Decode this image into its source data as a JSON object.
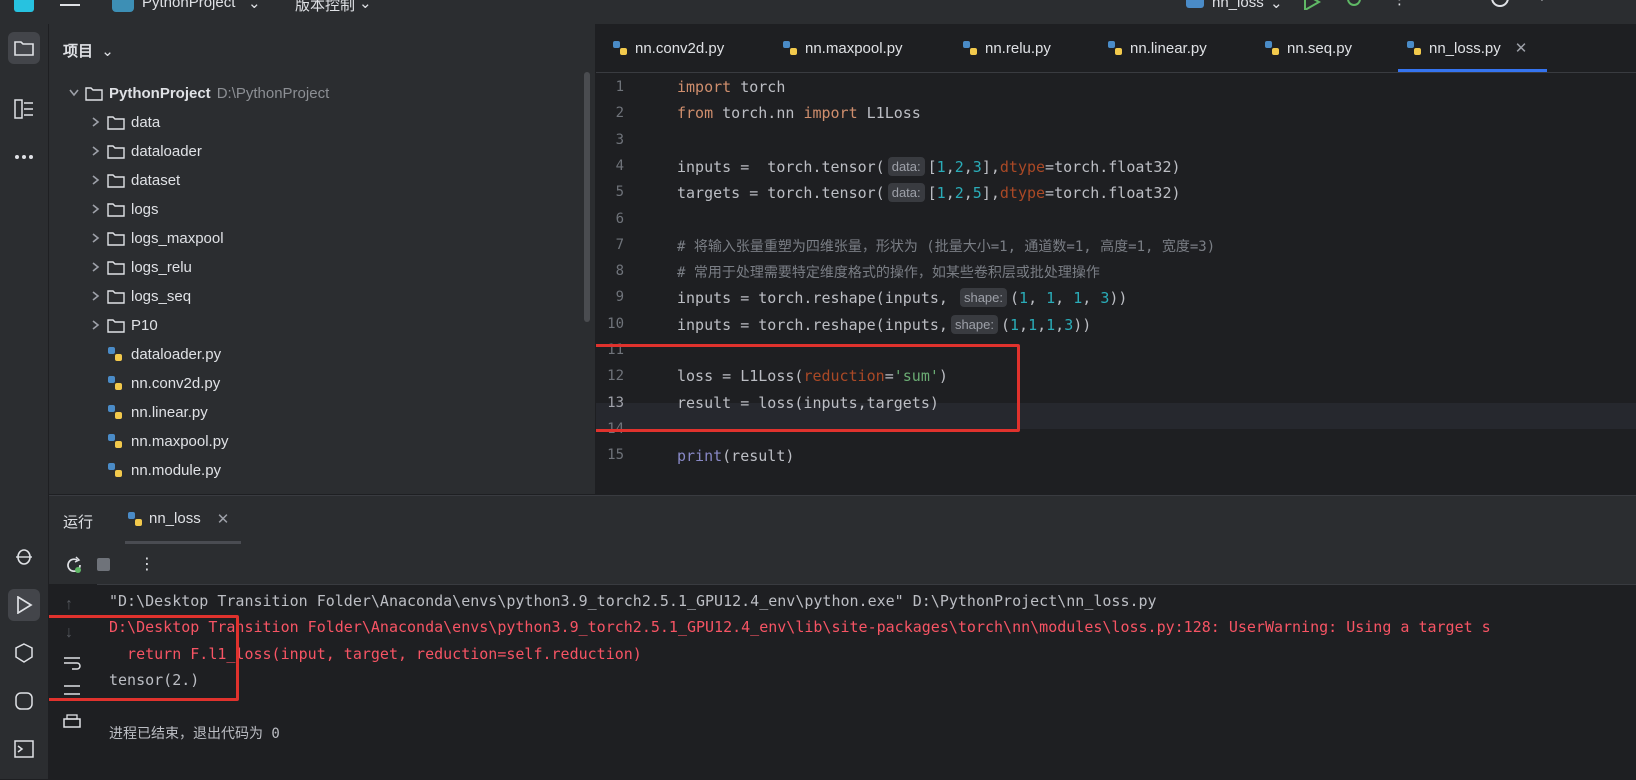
{
  "titlebar": {
    "project_name": "PythonProject",
    "vcs_label": "版本控制",
    "run_config": "nn_loss"
  },
  "project_panel": {
    "title": "项目",
    "root": {
      "name": "PythonProject",
      "path": "D:\\PythonProject"
    },
    "folders": [
      "data",
      "dataloader",
      "dataset",
      "logs",
      "logs_maxpool",
      "logs_relu",
      "logs_seq",
      "P10"
    ],
    "files": [
      "dataloader.py",
      "nn.conv2d.py",
      "nn.linear.py",
      "nn.maxpool.py",
      "nn.module.py"
    ]
  },
  "editor": {
    "tabs": [
      "nn.conv2d.py",
      "nn.maxpool.py",
      "nn.relu.py",
      "nn.linear.py",
      "nn.seq.py",
      "nn_loss.py"
    ],
    "active_tab": "nn_loss.py",
    "line_numbers": [
      "1",
      "2",
      "3",
      "4",
      "5",
      "6",
      "7",
      "8",
      "9",
      "10",
      "11",
      "12",
      "13",
      "14",
      "15"
    ],
    "hints": {
      "data": "data:",
      "shape": "shape:"
    },
    "code": {
      "l1_kw": "import",
      "l1_rest": " torch",
      "l2_kw1": "from",
      "l2_mid": " torch.nn ",
      "l2_kw2": "import",
      "l2_rest": " L1Loss",
      "l4_a": "inputs =  torch.tensor(",
      "l4_b": "[",
      "l4_n1": "1",
      "l4_n2": "2",
      "l4_n3": "3",
      "l4_c": "],",
      "l4_param": "dtype",
      "l4_d": "=torch.float32)",
      "l5_a": "targets = torch.tensor(",
      "l5_b": "[",
      "l5_n1": "1",
      "l5_n2": "2",
      "l5_n3": "5",
      "l5_c": "],",
      "l5_param": "dtype",
      "l5_d": "=torch.float32)",
      "l7": "# 将输入张量重塑为四维张量，形状为 (批量大小=1, 通道数=1, 高度=1, 宽度=3)",
      "l8": "# 常用于处理需要特定维度格式的操作，如某些卷积层或批处理操作",
      "l9_a": "inputs = torch.reshape(inputs, ",
      "l9_b": "(",
      "l9_n1": "1",
      "l9_n2": "1",
      "l9_n3": "1",
      "l9_n4": "3",
      "l9_c": "))",
      "l10_a": "inputs = torch.reshape(inputs,",
      "l10_b": "(",
      "l10_n1": "1",
      "l10_n2": "1",
      "l10_n3": "1",
      "l10_n4": "3",
      "l10_c": "))",
      "l12_a": "loss = L1Loss(",
      "l12_param": "reduction",
      "l12_eq": "=",
      "l12_str": "'sum'",
      "l12_c": ")",
      "l13": "result = loss(inputs,targets)",
      "l15_fn": "print",
      "l15_rest": "(result)"
    }
  },
  "run_panel": {
    "title": "运行",
    "tab": "nn_loss",
    "output": [
      "\"D:\\Desktop Transition Folder\\Anaconda\\envs\\python3.9_torch2.5.1_GPU12.4_env\\python.exe\" D:\\PythonProject\\nn_loss.py",
      "D:\\Desktop Transition Folder\\Anaconda\\envs\\python3.9_torch2.5.1_GPU12.4_env\\lib\\site-packages\\torch\\nn\\modules\\loss.py:128: UserWarning: Using a target s",
      "  return F.l1_loss(input, target, reduction=self.reduction)",
      "tensor(2.)",
      "进程已结束，退出代码为 0"
    ]
  },
  "colors": {
    "accent": "#3574f0",
    "highlight_box": "#e0322d",
    "error_text": "#f75464",
    "keyword": "#cf8e6d",
    "number": "#2aacb8"
  }
}
